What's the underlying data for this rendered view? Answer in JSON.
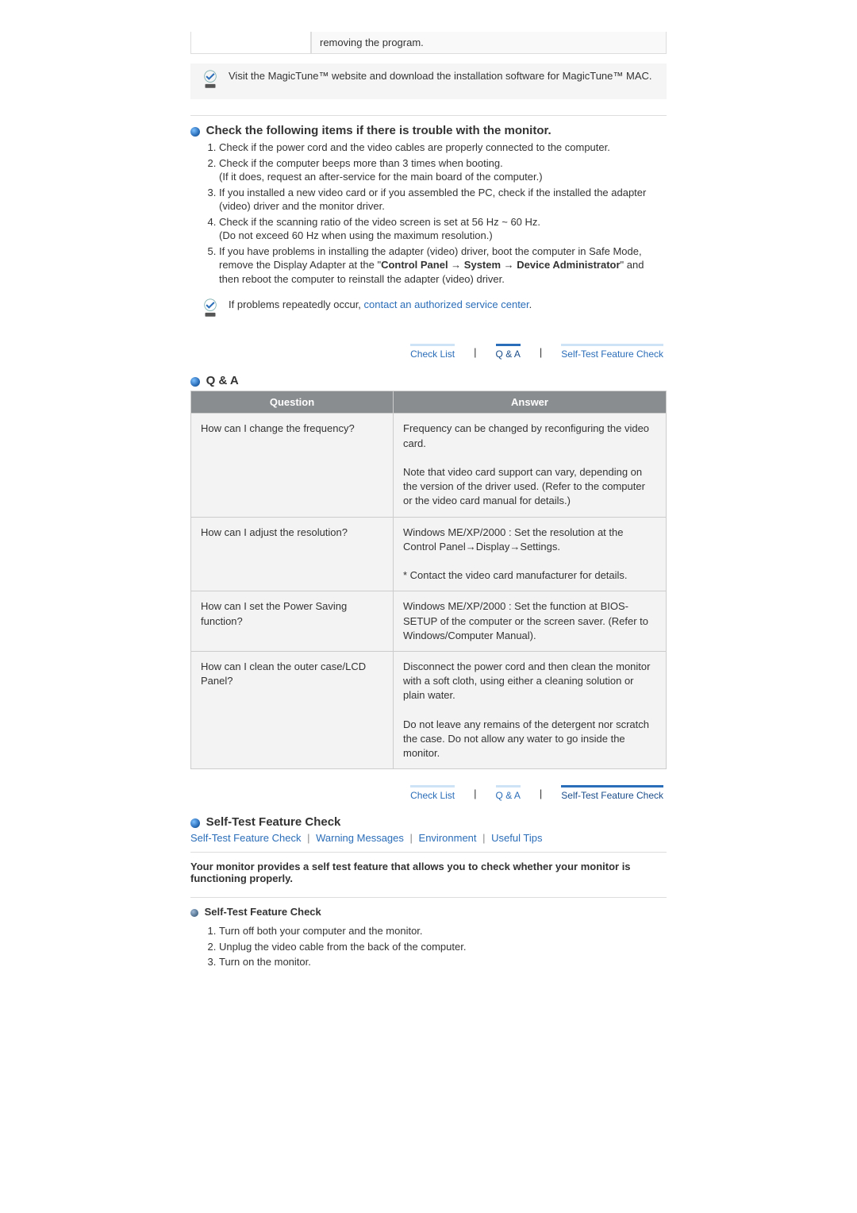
{
  "topnote": {
    "cell_text": "removing the program.",
    "info_text": "Visit the MagicTune™ website and download the installation software for MagicTune™ MAC."
  },
  "section1": {
    "heading": "Check the following items if there is trouble with the monitor.",
    "items": [
      "Check if the power cord and the video cables are properly connected to the computer.",
      "Check if the computer beeps more than 3 times when booting.\n(If it does, request an after-service for the main board of the computer.)",
      "If you installed a new video card or if you assembled the PC, check if the installed the adapter (video) driver and the monitor driver.",
      "Check if the scanning ratio of the video screen is set at 56 Hz ~ 60 Hz.\n(Do not exceed 60 Hz when using the maximum resolution.)",
      "If you have problems in installing the adapter (video) driver, boot the computer in Safe Mode, remove the Display Adapter at the \"Control Panel → System → Device Administrator\" and then reboot the computer to reinstall the adapter (video) driver."
    ],
    "info_prefix": "If problems repeatedly occur, ",
    "info_link": "contact an authorized service center",
    "info_suffix": "."
  },
  "tabs": {
    "checklist": "Check List",
    "qa": "Q & A",
    "selftest": "Self-Test Feature Check"
  },
  "qa": {
    "heading": "Q & A",
    "col_q": "Question",
    "col_a": "Answer",
    "rows": [
      {
        "q": "How can I change the frequency?",
        "a": "Frequency can be changed by reconfiguring the video card.\n\nNote that video card support can vary, depending on the version of the driver used. (Refer to the computer or the video card manual for details.)"
      },
      {
        "q": "How can I adjust the resolution?",
        "a": "Windows ME/XP/2000 : Set the resolution at the Control Panel→Display→Settings.\n\n* Contact the video card manufacturer for details."
      },
      {
        "q": "How can I set the Power Saving function?",
        "a": "Windows ME/XP/2000 : Set the function at BIOS-SETUP of the computer or the screen saver. (Refer to Windows/Computer Manual)."
      },
      {
        "q": "How can I clean the outer case/LCD Panel?",
        "a": "Disconnect the power cord and then clean the monitor with a soft cloth, using either a cleaning solution or plain water.\n\nDo not leave any remains of the detergent nor scratch the case. Do not allow any water to go inside the monitor."
      }
    ]
  },
  "selftest": {
    "heading": "Self-Test Feature Check",
    "anchors": {
      "a1": "Self-Test Feature Check",
      "a2": "Warning Messages",
      "a3": "Environment",
      "a4": "Useful Tips"
    },
    "intro": "Your monitor provides a self test feature that allows you to check whether your monitor is functioning properly.",
    "subheading": "Self-Test Feature Check",
    "steps": [
      "Turn off both your computer and the monitor.",
      "Unplug the video cable from the back of the computer.",
      "Turn on the monitor."
    ]
  }
}
